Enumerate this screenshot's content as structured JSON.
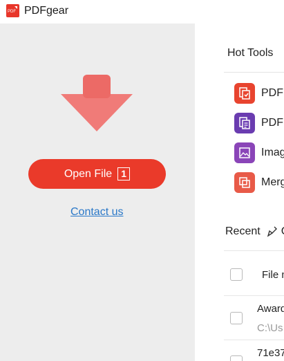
{
  "app": {
    "title": "PDFgear",
    "logo_text": "PDF"
  },
  "main": {
    "open_button": {
      "label": "Open File",
      "shortcut": "1"
    },
    "contact_link": "Contact us"
  },
  "hot_tools": {
    "title": "Hot Tools",
    "items": [
      {
        "label": "PDF",
        "icon": "pdf-to-word-icon",
        "color": "#e8442f"
      },
      {
        "label": "PDF",
        "icon": "pdf-to-text-icon",
        "color": "#6a3cb0"
      },
      {
        "label": "Imag",
        "icon": "image-to-pdf-icon",
        "color": "#8a45b8"
      },
      {
        "label": "Merg",
        "icon": "merge-pdf-icon",
        "color": "#e85a48"
      }
    ]
  },
  "recent": {
    "title": "Recent",
    "more": "C",
    "columns": {
      "file": "File n"
    },
    "rows": [
      {
        "name": "Award",
        "path": "C:\\Us"
      },
      {
        "name": "71e37",
        "path": ""
      }
    ]
  },
  "colors": {
    "accent": "#ea3a2a",
    "link": "#2a78c8",
    "left_panel": "#ededed"
  }
}
